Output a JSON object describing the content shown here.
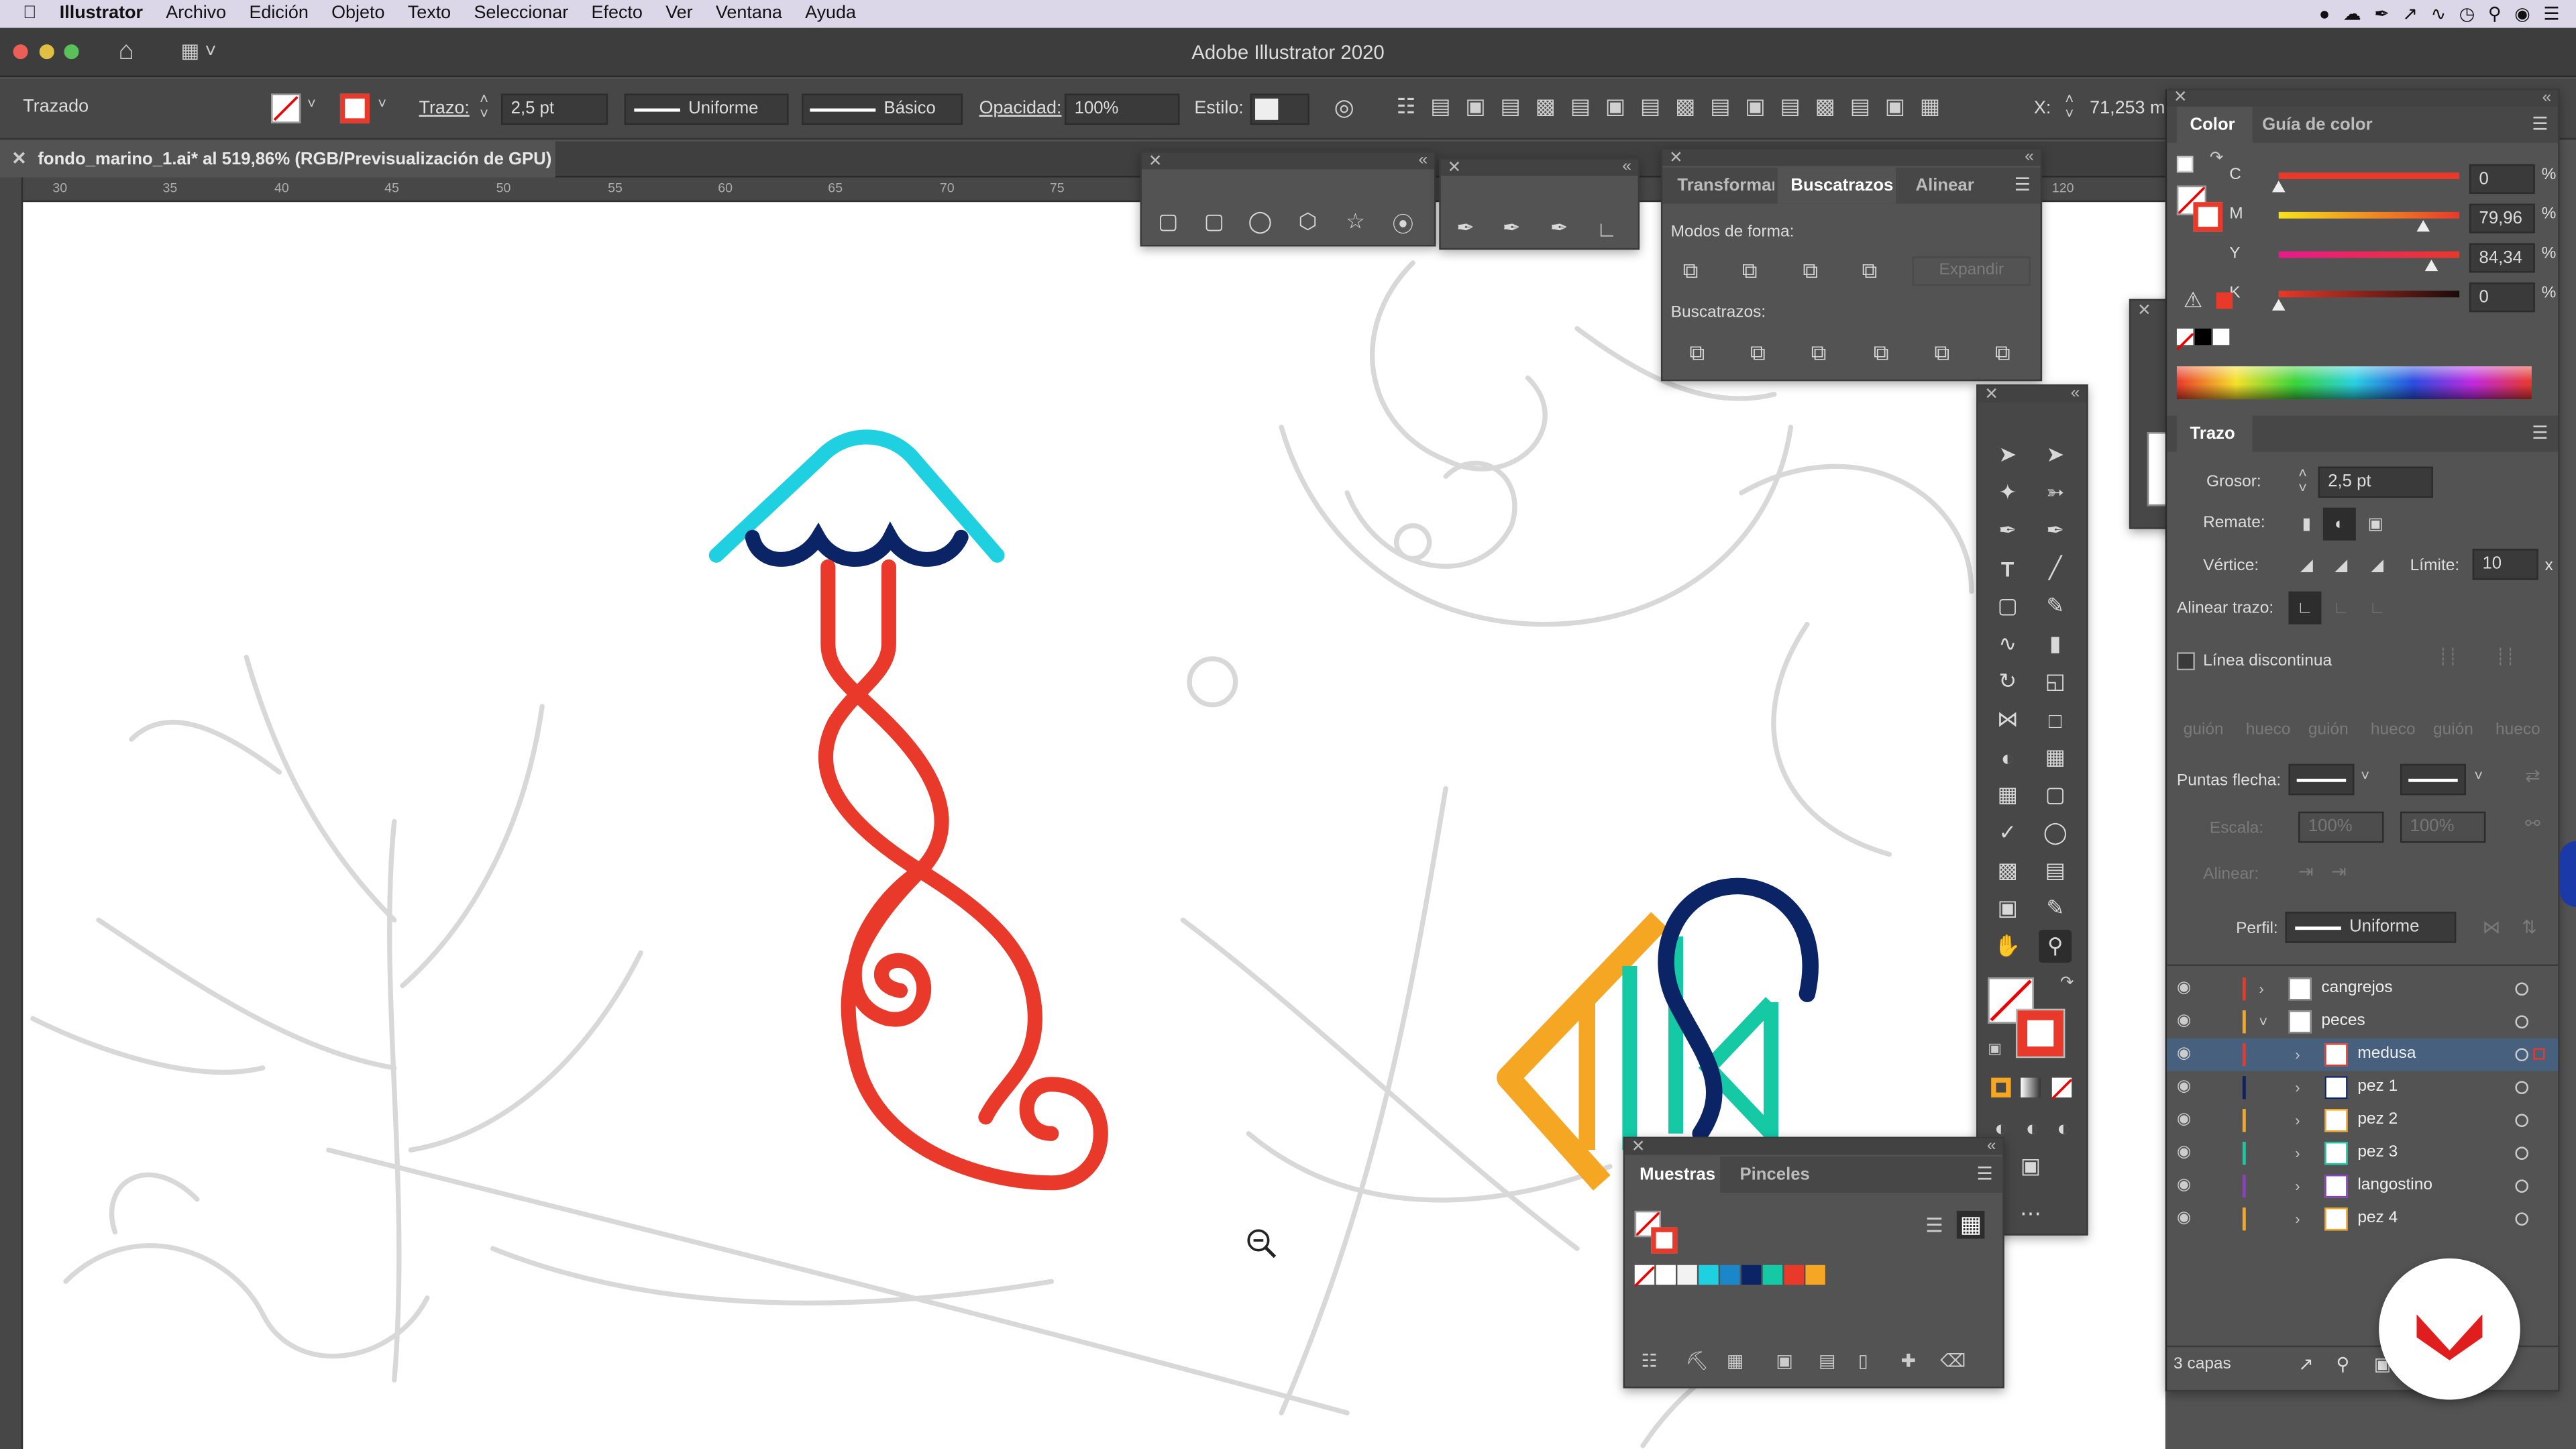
{
  "menubar": {
    "app": "Illustrator",
    "items": [
      "Archivo",
      "Edición",
      "Objeto",
      "Texto",
      "Seleccionar",
      "Efecto",
      "Ver",
      "Ventana",
      "Ayuda"
    ]
  },
  "window": {
    "title": "Adobe Illustrator 2020"
  },
  "control_bar": {
    "selection_type": "Trazado",
    "stroke_label": "Trazo:",
    "stroke_value": "2,5 pt",
    "profile_value": "Uniforme",
    "brush_value": "Básico",
    "opacity_label": "Opacidad:",
    "opacity_value": "100%",
    "style_label": "Estilo:",
    "x_label": "X:",
    "x_value": "71,253 m"
  },
  "document_tab": {
    "title": "fondo_marino_1.ai* al 519,86% (RGB/Previsualización de GPU)"
  },
  "ruler": {
    "top_ticks": [
      "30",
      "35",
      "40",
      "45",
      "50",
      "55",
      "60",
      "65",
      "70",
      "75",
      "120"
    ]
  },
  "pathfinder_panel": {
    "tabs": [
      "Transformar",
      "Buscatrazos",
      "Alinear"
    ],
    "shape_modes_label": "Modos de forma:",
    "expand_label": "Expandir",
    "pathfinders_label": "Buscatrazos:"
  },
  "color_panel": {
    "tabs": [
      "Color",
      "Guía de color"
    ],
    "channels": [
      {
        "name": "C",
        "value": "0",
        "fraction": 0.0,
        "unit": "%"
      },
      {
        "name": "M",
        "value": "79,96",
        "fraction": 0.7996,
        "unit": "%"
      },
      {
        "name": "Y",
        "value": "84,34",
        "fraction": 0.8434,
        "unit": "%"
      },
      {
        "name": "K",
        "value": "0",
        "fraction": 0.0,
        "unit": "%"
      }
    ]
  },
  "stroke_panel": {
    "title": "Trazo",
    "weight_label": "Grosor:",
    "weight_value": "2,5 pt",
    "cap_label": "Remate:",
    "corner_label": "Vértice:",
    "limit_label": "Límite:",
    "limit_value": "10",
    "limit_unit": "x",
    "align_label": "Alinear trazo:",
    "dashed_label": "Línea discontinua",
    "dash_labels": [
      "guión",
      "hueco",
      "guión",
      "hueco",
      "guión",
      "hueco"
    ],
    "arrowheads_label": "Puntas flecha:",
    "scale_label": "Escala:",
    "scale_value_1": "100%",
    "scale_value_2": "100%",
    "align_arrows_label": "Alinear:",
    "profile_label": "Perfil:",
    "profile_value": "Uniforme"
  },
  "swatches_panel": {
    "tabs": [
      "Muestras",
      "Pinceles"
    ],
    "swatch_colors": [
      "#ffffff",
      "#e6e6e6",
      "#f2f2f2",
      "#1fd0e0",
      "#1b86c8",
      "#0b2466",
      "#15c9a5",
      "#e8392a",
      "#f5a623"
    ]
  },
  "layers_panel": {
    "rows": [
      {
        "name": "cangrejos",
        "color": "#e8392a",
        "indent": 0,
        "expanded": false,
        "selected": false
      },
      {
        "name": "peces",
        "color": "#f5a623",
        "indent": 0,
        "expanded": true,
        "selected": false
      },
      {
        "name": "medusa",
        "color": "#e8392a",
        "indent": 1,
        "expanded": false,
        "selected": true
      },
      {
        "name": "pez 1",
        "color": "#0b2466",
        "indent": 1,
        "expanded": false,
        "selected": false
      },
      {
        "name": "pez 2",
        "color": "#f5a623",
        "indent": 1,
        "expanded": false,
        "selected": false
      },
      {
        "name": "pez 3",
        "color": "#15c9a5",
        "indent": 1,
        "expanded": false,
        "selected": false
      },
      {
        "name": "langostino",
        "color": "#8a3fc2",
        "indent": 1,
        "expanded": false,
        "selected": false
      },
      {
        "name": "pez 4",
        "color": "#f5a623",
        "indent": 1,
        "expanded": false,
        "selected": false
      }
    ],
    "count_label": "3 capas"
  },
  "colors": {
    "jellyfish_head": "#1fd0e0",
    "jellyfish_scallops": "#0b2466",
    "jellyfish_tentacle": "#e8392a",
    "fish_orange": "#f5a623",
    "fish_teal": "#15c9a5",
    "fish_navy": "#0b2466",
    "sketch": "#d6d6d6",
    "selection": "#46607e"
  }
}
